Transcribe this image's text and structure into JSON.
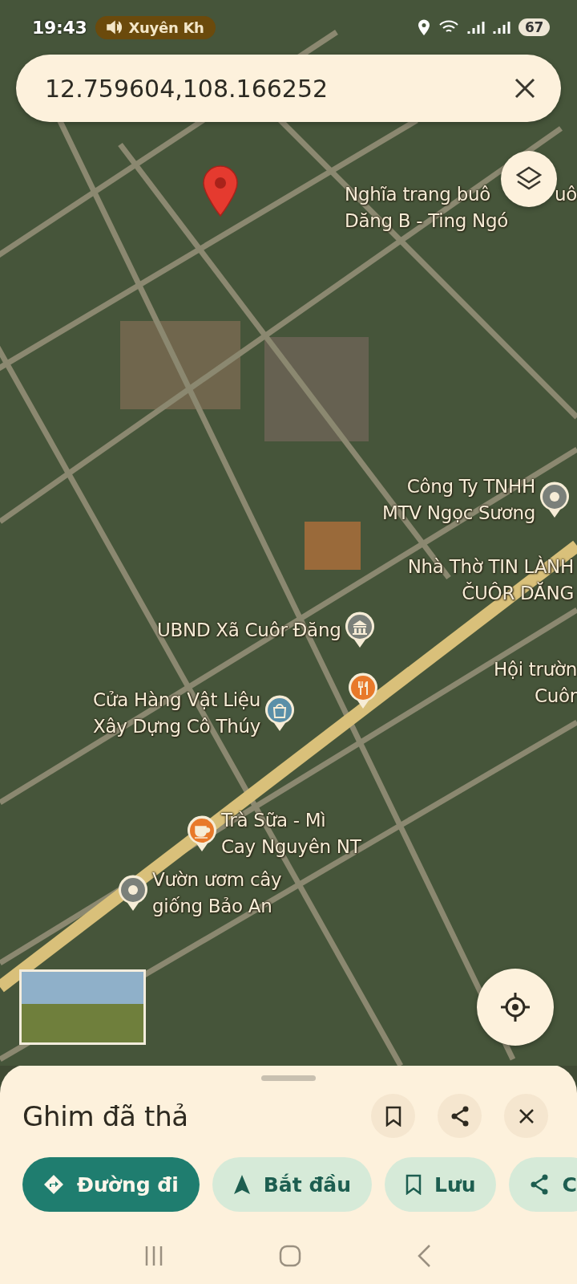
{
  "status_bar": {
    "time": "19:43",
    "media_chip": "Xuyên Kh",
    "battery": "67"
  },
  "search": {
    "value": "12.759604,108.166252"
  },
  "map": {
    "places": [
      {
        "lines": [
          "Nghĩa trang buô",
          "Dăng B - Ting Ngó"
        ]
      },
      {
        "lines": [
          "uô"
        ]
      },
      {
        "lines": [
          "Công Ty TNHH",
          "MTV Ngọc Sương"
        ],
        "kind": "pin"
      },
      {
        "lines": [
          "Nhà Thờ TIN LÀNH",
          "ČUÔR DĂNG"
        ]
      },
      {
        "lines": [
          "UBND Xã Cuôr Đăng"
        ],
        "kind": "building"
      },
      {
        "lines": [
          "Hội trườn",
          "Cuôr"
        ]
      },
      {
        "kind": "restaurant"
      },
      {
        "lines": [
          "Cửa Hàng Vật Liệu",
          "Xây Dựng Cô Thúy"
        ],
        "kind": "shop"
      },
      {
        "lines": [
          "Trà Sữa - Mì",
          "Cay Nguyên NT"
        ],
        "kind": "cafe"
      },
      {
        "lines": [
          "Vườn ươm cây",
          "giống Bảo An"
        ],
        "kind": "pin"
      }
    ]
  },
  "sheet": {
    "title": "Ghim đã thả",
    "actions": [
      {
        "kind": "directions",
        "label": "Đường đi"
      },
      {
        "kind": "start",
        "label": "Bắt đầu"
      },
      {
        "kind": "save",
        "label": "Lưu"
      },
      {
        "kind": "share",
        "label": "C"
      }
    ]
  }
}
